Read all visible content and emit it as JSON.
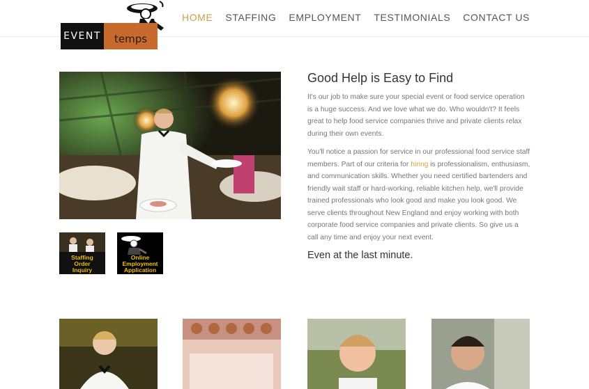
{
  "logo": {
    "word_event": "EVENT",
    "word_temps": "temps"
  },
  "nav": {
    "items": [
      {
        "label": "HOME",
        "active": true
      },
      {
        "label": "STAFFING",
        "active": false
      },
      {
        "label": "EMPLOYMENT",
        "active": false
      },
      {
        "label": "TESTIMONIALS",
        "active": false
      },
      {
        "label": "CONTACT US",
        "active": false
      }
    ],
    "active_color": "#c8a050"
  },
  "tiles": {
    "staffing": {
      "line1": "Staffing",
      "line2": "Order",
      "line3": "Inquiry"
    },
    "employment": {
      "line1": "Online",
      "line2": "Employment",
      "line3": "Application"
    }
  },
  "content": {
    "heading": "Good Help is Easy to Find",
    "para1": "It's our job to make sure your special event or food service operation is a huge success. And we love what we do. Who wouldn't? It feels great to help food service companies thrive and private clients relax during their own events.",
    "para2_before": "You'll notice a passion for service in our professional food service staff members. Part of our criteria for ",
    "para2_link": "hiring",
    "para2_after": " is professionalism, enthusiasm, and communication skills. Whether you need certified bartenders and friendly wait staff or hard-working, reliable kitchen help, we'll provide trained professionals who look good and make you look good. We serve clients throughout New England and enjoy working with both corporate food service companies and private clients. So give us a call any time and enjoy your next event.",
    "tagline": "Even at the last minute."
  },
  "colors": {
    "brand_orange": "#c86a2c",
    "link_gold": "#d9a441"
  }
}
